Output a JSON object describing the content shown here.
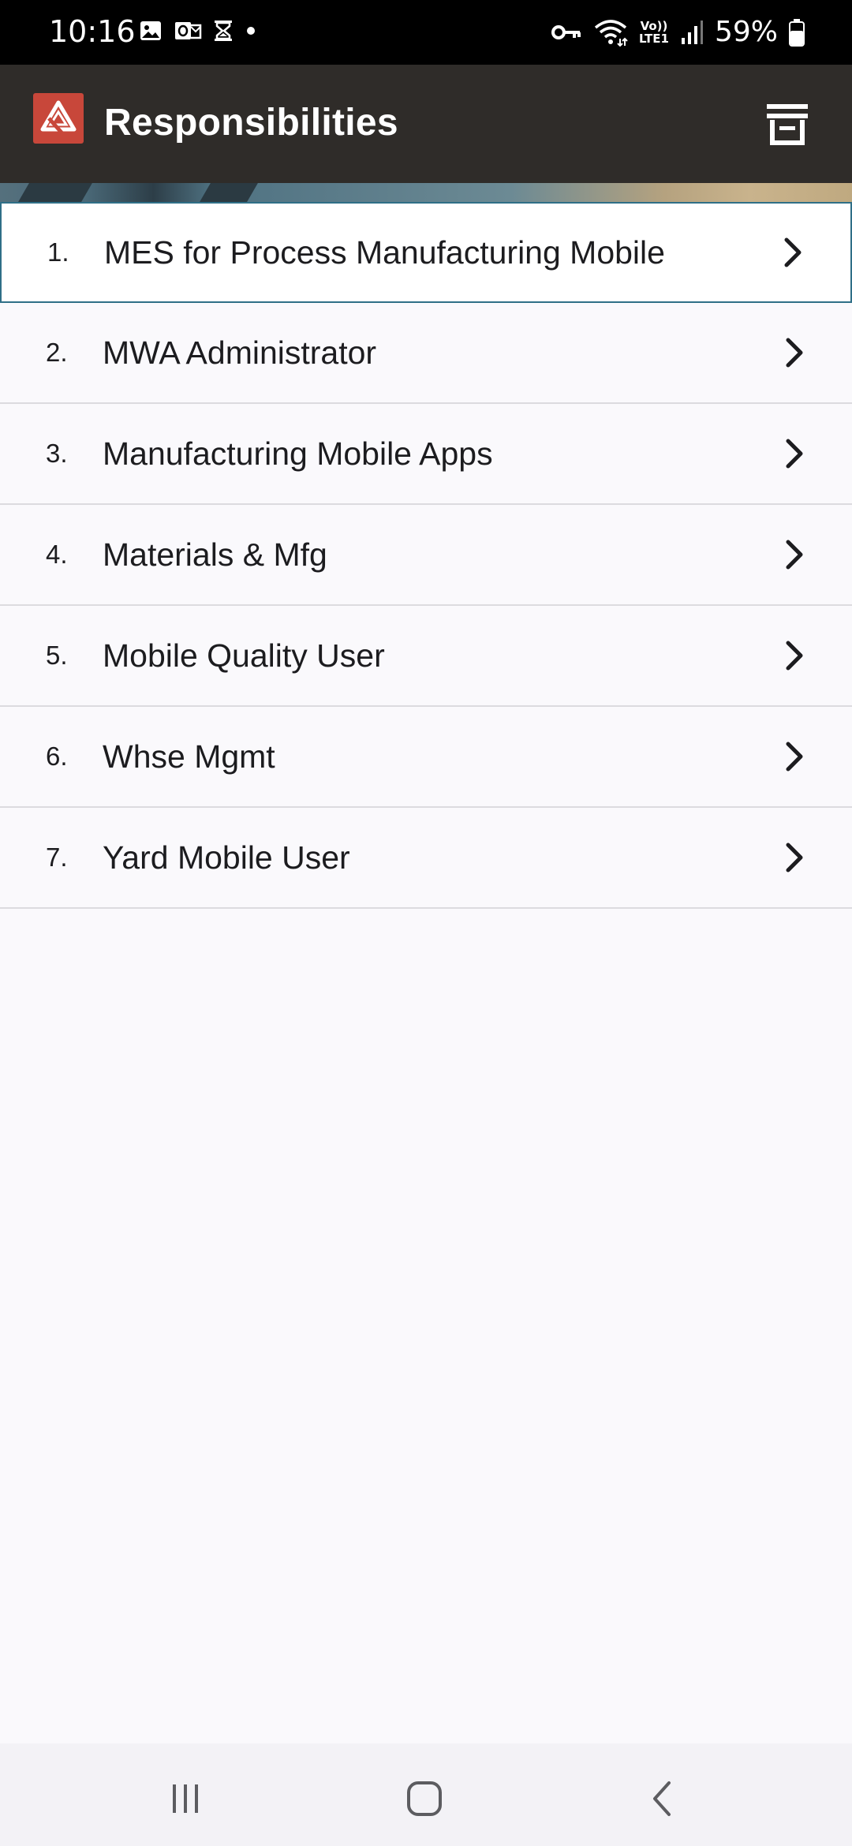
{
  "status_bar": {
    "time": "10:16",
    "battery": "59%",
    "notification_icons": [
      "image-icon",
      "outlook-icon",
      "hourglass-icon",
      "dot-icon"
    ],
    "system_icons": [
      "vpn-key-icon",
      "wifi-icon",
      "volte-icon",
      "signal-icon",
      "battery-icon"
    ],
    "volte_label_top": "Vo))",
    "volte_label_bottom": "LTE1"
  },
  "app_bar": {
    "title": "Responsibilities",
    "logo_color": "#c8473a",
    "background_color": "#2f2c29"
  },
  "responsibilities": [
    {
      "number": "1.",
      "label": "MES for Process Manufacturing Mobile",
      "selected": true
    },
    {
      "number": "2.",
      "label": "MWA Administrator",
      "selected": false
    },
    {
      "number": "3.",
      "label": "Manufacturing Mobile Apps",
      "selected": false
    },
    {
      "number": "4.",
      "label": "Materials & Mfg",
      "selected": false
    },
    {
      "number": "5.",
      "label": "Mobile Quality User",
      "selected": false
    },
    {
      "number": "6.",
      "label": "Whse Mgmt",
      "selected": false
    },
    {
      "number": "7.",
      "label": "Yard Mobile User",
      "selected": false
    }
  ],
  "nav_bar": {
    "buttons": [
      "recents-icon",
      "home-icon",
      "back-icon"
    ]
  }
}
